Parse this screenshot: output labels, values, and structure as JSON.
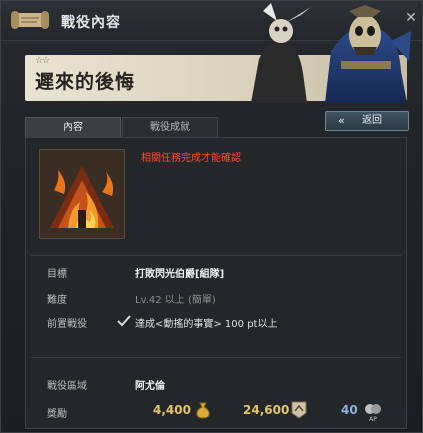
{
  "window": {
    "title": "戰役內容",
    "close_glyph": "✕"
  },
  "quest": {
    "stars": "☆☆",
    "name": "遲來的後悔"
  },
  "tabs": [
    {
      "label": "內容",
      "active": true
    },
    {
      "label": "戰役成就",
      "active": false
    }
  ],
  "back_button": {
    "arrow": "«",
    "label": "返回"
  },
  "notice": "相關任務完成才能確認",
  "details": {
    "objective": {
      "label": "目標",
      "value": "打敗閃光伯爵[組隊]"
    },
    "difficulty": {
      "label": "難度",
      "value": "Lv.42 以上 (簡單)"
    },
    "prerequisite": {
      "label": "前置戰役",
      "value": "達成<動搖的事實> 100 pt以上"
    },
    "region": {
      "label": "戰役區域",
      "value": "阿尤倫"
    },
    "reward": {
      "label": "獎勵",
      "gold": "4,400",
      "exp": "24,600",
      "ap": "40"
    }
  },
  "icons": {
    "scroll": "scroll-icon",
    "quest": "burning-house-icon",
    "check": "check-icon",
    "gold": "gold-pouch-icon",
    "exp": "exp-badge-icon",
    "ap": "ap-icon"
  },
  "colors": {
    "notice": "#ff4a2b",
    "reward_gold": "#e6c36a",
    "reward_ap": "#8fb0e0",
    "banner": "#e9e3d3"
  }
}
